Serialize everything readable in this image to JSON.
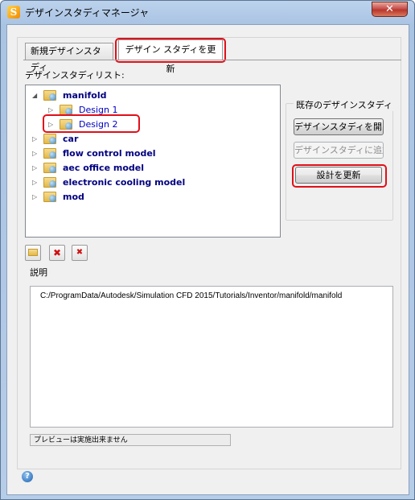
{
  "window": {
    "title": "デザインスタディマネージャ",
    "close_label": "✕"
  },
  "tabs": [
    {
      "label": "新規デザインスタディ",
      "selected": false
    },
    {
      "label": "デザイン スタディを更新",
      "selected": true
    }
  ],
  "study_list_label": "デザインスタディリスト:",
  "tree": [
    {
      "label": "manifold",
      "expanded": true,
      "children": [
        "Design 1",
        "Design 2"
      ]
    },
    {
      "label": "car"
    },
    {
      "label": "flow control model"
    },
    {
      "label": "aec office model"
    },
    {
      "label": "electronic cooling model"
    },
    {
      "label": "mod"
    }
  ],
  "existing_group": {
    "title": "既存のデザインスタディ",
    "open_label": "デザインスタディを開く",
    "add_label": "デザインスタディに追加",
    "update_label": "設計を更新"
  },
  "description": {
    "label": "説明",
    "text": "C:/ProgramData/Autodesk/Simulation CFD 2015/Tutorials/Inventor/manifold/manifold"
  },
  "status": "プレビューは実施出来ません",
  "colors": {
    "highlight": "#e0101a",
    "tree_link": "#0000c0",
    "tree_bold": "#000080"
  }
}
